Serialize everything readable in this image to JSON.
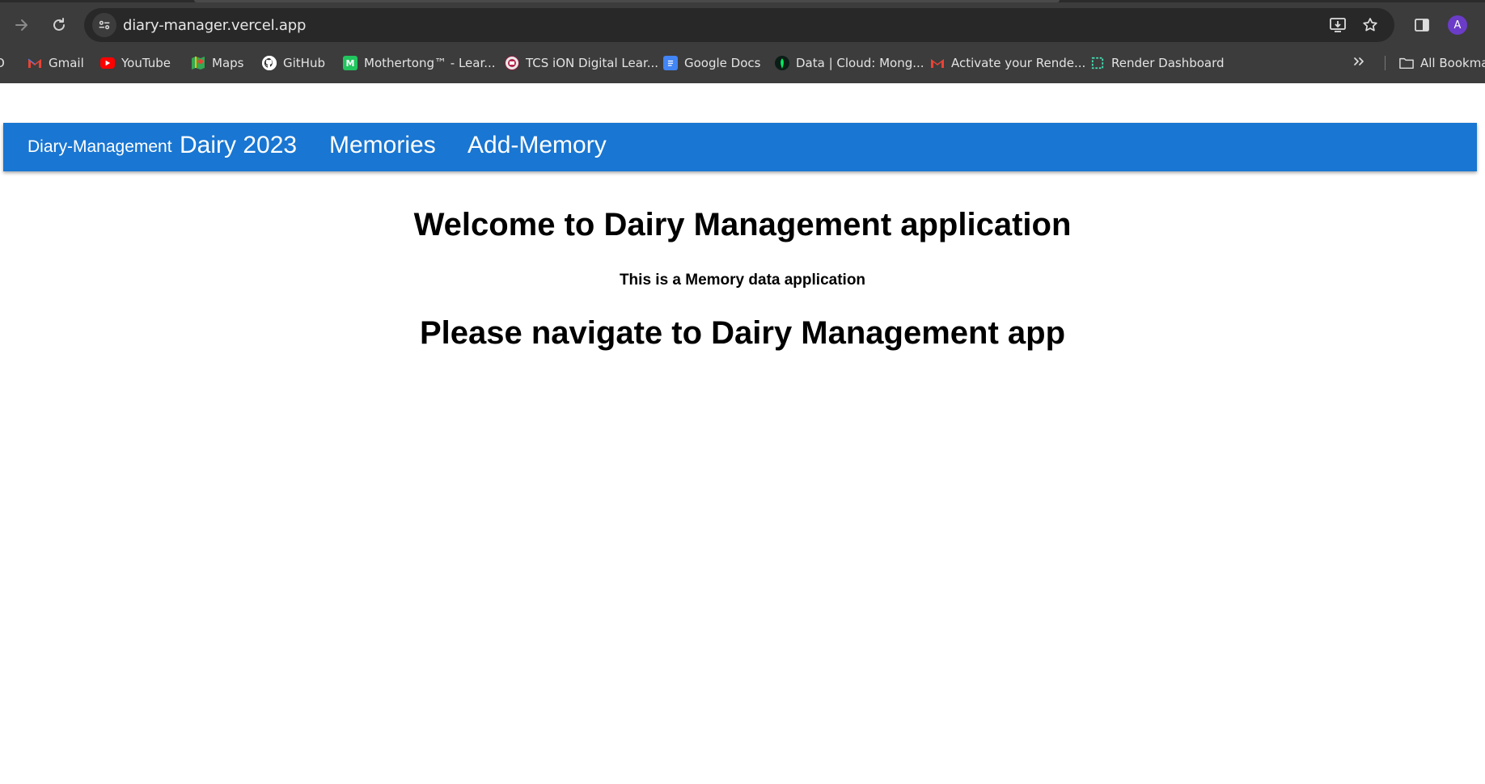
{
  "browser": {
    "url": "diary-manager.vercel.app",
    "profile_initial": "A",
    "bookmarks": [
      {
        "label": "Gmail",
        "icon": "gmail-icon"
      },
      {
        "label": "YouTube",
        "icon": "youtube-icon"
      },
      {
        "label": "Maps",
        "icon": "maps-icon"
      },
      {
        "label": "GitHub",
        "icon": "github-icon"
      },
      {
        "label": "Mothertong™ - Lear...",
        "icon": "mothertong-icon"
      },
      {
        "label": "TCS iON Digital Lear...",
        "icon": "tcs-ion-icon"
      },
      {
        "label": "Google Docs",
        "icon": "google-docs-icon"
      },
      {
        "label": "Data | Cloud: Mong...",
        "icon": "mongodb-icon"
      },
      {
        "label": "Activate your Rende...",
        "icon": "gmail-icon"
      },
      {
        "label": "Render Dashboard",
        "icon": "render-icon"
      }
    ],
    "all_bookmarks_label": "All Bookma"
  },
  "app": {
    "brand": "Diary-Management",
    "nav": [
      "Dairy 2023",
      "Memories",
      "Add-Memory"
    ],
    "nav_color": "#1976d2"
  },
  "main": {
    "heading": "Welcome to Dairy Management application",
    "subtitle": "This is a Memory data application",
    "cta_heading": "Please navigate to Dairy Management app"
  }
}
